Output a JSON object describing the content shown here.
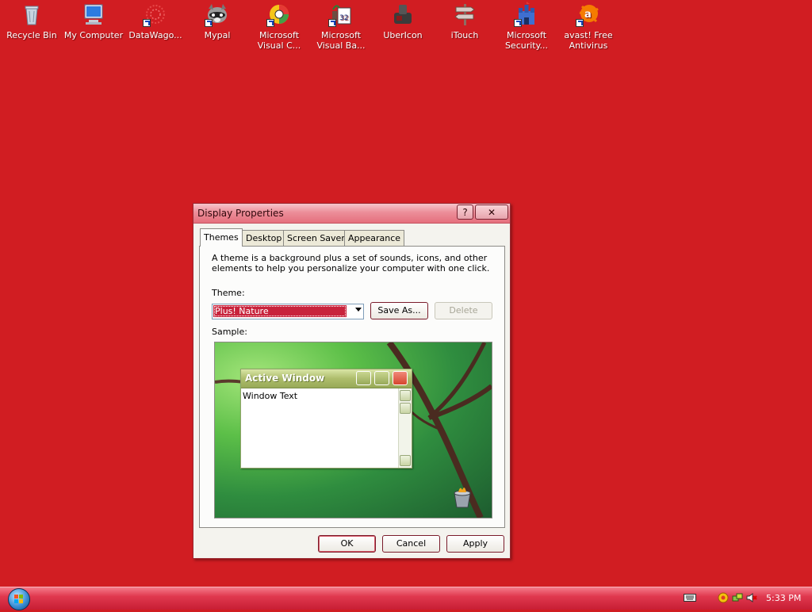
{
  "desktop": {
    "icons": [
      {
        "label": "Recycle Bin",
        "icon": "recycle-bin-icon"
      },
      {
        "label": "My Computer",
        "icon": "computer-icon"
      },
      {
        "label": "DataWago...",
        "icon": "datawagon-icon"
      },
      {
        "label": "Mypal",
        "icon": "mypal-raccoon-icon"
      },
      {
        "label": "Microsoft Visual C...",
        "icon": "visual-c-icon"
      },
      {
        "label": "Microsoft Visual Ba...",
        "icon": "visual-basic-icon"
      },
      {
        "label": "UberIcon",
        "icon": "ubericon-icon"
      },
      {
        "label": "iTouch",
        "icon": "signpost-icon"
      },
      {
        "label": "Microsoft Security...",
        "icon": "security-castle-icon"
      },
      {
        "label": "avast! Free Antivirus",
        "icon": "avast-icon"
      }
    ]
  },
  "dialog": {
    "title": "Display Properties",
    "help_glyph": "?",
    "close_glyph": "✕",
    "tabs": [
      {
        "label": "Themes",
        "active": true
      },
      {
        "label": "Desktop",
        "active": false
      },
      {
        "label": "Screen Saver",
        "active": false
      },
      {
        "label": "Appearance",
        "active": false
      }
    ],
    "description": "A theme is a background plus a set of sounds, icons, and other elements to help you personalize your computer with one click.",
    "theme_label": "Theme:",
    "theme_value": "Plus! Nature",
    "save_as_label": "Save As...",
    "delete_label": "Delete",
    "sample_label": "Sample:",
    "sample": {
      "window_title": "Active Window",
      "window_text": "Window Text"
    },
    "ok_label": "OK",
    "cancel_label": "Cancel",
    "apply_label": "Apply"
  },
  "taskbar": {
    "clock": "5:33 PM",
    "tray_icons": [
      "keyboard-icon",
      "browser-icon",
      "network-icon",
      "volume-muted-icon"
    ]
  },
  "colors": {
    "desktop_background": "#d11d22",
    "taskbar": "#e0394f",
    "selection": "#c8233c"
  }
}
